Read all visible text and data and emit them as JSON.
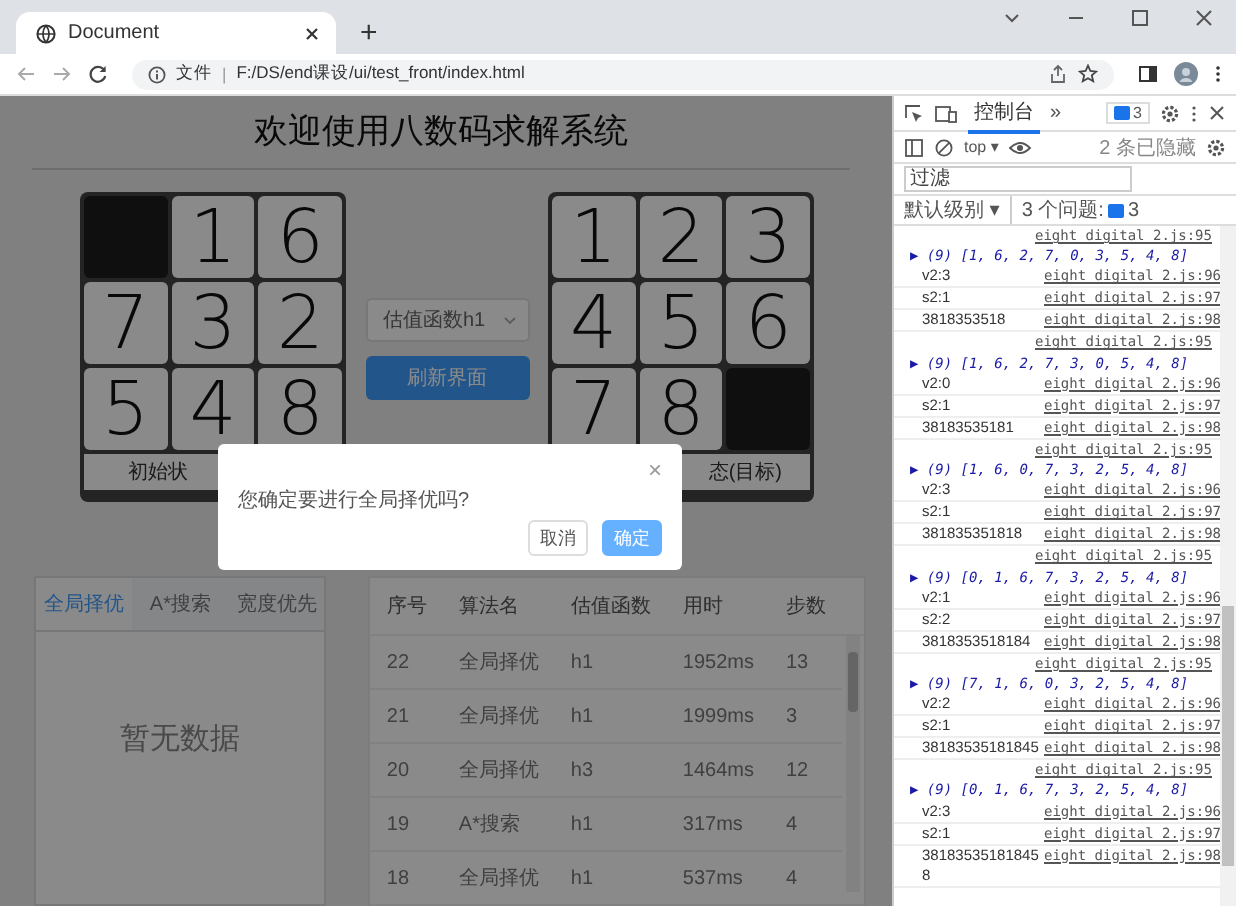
{
  "browser": {
    "tab_title": "Document",
    "new_tab": "+",
    "address_scheme": "文件",
    "address_separator": "|",
    "address": "F:/DS/end课设/ui/test_front/index.html"
  },
  "app": {
    "title": "欢迎使用八数码求解系统",
    "puzzles": [
      {
        "caption": "初始状",
        "tiles": [
          {
            "kind": "blank"
          },
          {
            "kind": "number",
            "label": "1"
          },
          {
            "kind": "number",
            "label": "6"
          },
          {
            "kind": "number",
            "label": "7"
          },
          {
            "kind": "number",
            "label": "3"
          },
          {
            "kind": "number",
            "label": "2"
          },
          {
            "kind": "number",
            "label": "5"
          },
          {
            "kind": "number",
            "label": "4"
          },
          {
            "kind": "number",
            "label": "8"
          }
        ]
      },
      {
        "caption": "态(目标)",
        "tiles": [
          {
            "kind": "number",
            "label": "1"
          },
          {
            "kind": "number",
            "label": "2"
          },
          {
            "kind": "number",
            "label": "3"
          },
          {
            "kind": "number",
            "label": "4"
          },
          {
            "kind": "number",
            "label": "5"
          },
          {
            "kind": "number",
            "label": "6"
          },
          {
            "kind": "number",
            "label": "7"
          },
          {
            "kind": "number",
            "label": "8"
          },
          {
            "kind": "blank"
          }
        ]
      }
    ],
    "select": {
      "value": "估值函数h1"
    },
    "refresh_button": "刷新界面",
    "result_tabs": [
      {
        "label": "全局择优",
        "selected": true
      },
      {
        "label": "A*搜索",
        "selected": false
      },
      {
        "label": "宽度优先",
        "selected": false
      }
    ],
    "empty_text": "暂无数据",
    "table": {
      "columns": [
        "序号",
        "算法名",
        "估值函数",
        "用时",
        "步数"
      ],
      "rows": [
        [
          "22",
          "全局择优",
          "h1",
          "1952ms",
          "13"
        ],
        [
          "21",
          "全局择优",
          "h1",
          "1999ms",
          "3"
        ],
        [
          "20",
          "全局择优",
          "h3",
          "1464ms",
          "12"
        ],
        [
          "19",
          "A*搜索",
          "h1",
          "317ms",
          "4"
        ],
        [
          "18",
          "全局择优",
          "h1",
          "537ms",
          "4"
        ]
      ]
    }
  },
  "dialog": {
    "message": "您确定要进行全局择优吗?",
    "close": "×",
    "buttons": [
      {
        "label": "取消",
        "kind": "plain"
      },
      {
        "label": "确定",
        "kind": "primary"
      }
    ]
  },
  "devtools": {
    "tabs": [
      {
        "label": "控制台",
        "selected": true
      }
    ],
    "more": "»",
    "issues_badge": "3",
    "context": "top ▾",
    "hidden_count": "2 条已隐藏",
    "filter": {
      "placeholder": "过滤"
    },
    "levels": "默认级别 ▾",
    "issues_label": "3 个问题:",
    "issues_count": "3",
    "console": [
      {
        "kind": "source",
        "source": "eight_digital_2.js:95"
      },
      {
        "kind": "array",
        "text": "▶ (9) [1, 6, 2, 7, 0, 3, 5, 4, 8]"
      },
      {
        "kind": "log",
        "text": "v2:3",
        "source": "eight_digital_2.js:96"
      },
      {
        "kind": "log",
        "text": "s2:1",
        "source": "eight_digital_2.js:97"
      },
      {
        "kind": "log",
        "text": "3818353518",
        "source": "eight_digital_2.js:98"
      },
      {
        "kind": "source",
        "source": "eight_digital_2.js:95"
      },
      {
        "kind": "array",
        "text": "▶ (9) [1, 6, 2, 7, 3, 0, 5, 4, 8]"
      },
      {
        "kind": "log",
        "text": "v2:0",
        "source": "eight_digital_2.js:96"
      },
      {
        "kind": "log",
        "text": "s2:1",
        "source": "eight_digital_2.js:97"
      },
      {
        "kind": "log",
        "text": "38183535181",
        "source": "eight_digital_2.js:98"
      },
      {
        "kind": "source",
        "source": "eight_digital_2.js:95"
      },
      {
        "kind": "array",
        "text": "▶ (9) [1, 6, 0, 7, 3, 2, 5, 4, 8]"
      },
      {
        "kind": "log",
        "text": "v2:3",
        "source": "eight_digital_2.js:96"
      },
      {
        "kind": "log",
        "text": "s2:1",
        "source": "eight_digital_2.js:97"
      },
      {
        "kind": "log",
        "text": "381835351818",
        "source": "eight_digital_2.js:98"
      },
      {
        "kind": "source",
        "source": "eight_digital_2.js:95"
      },
      {
        "kind": "array",
        "text": "▶ (9) [0, 1, 6, 7, 3, 2, 5, 4, 8]"
      },
      {
        "kind": "log",
        "text": "v2:1",
        "source": "eight_digital_2.js:96"
      },
      {
        "kind": "log",
        "text": "s2:2",
        "source": "eight_digital_2.js:97"
      },
      {
        "kind": "log",
        "text": "3818353518184",
        "source": "eight_digital_2.js:98"
      },
      {
        "kind": "source",
        "source": "eight_digital_2.js:95"
      },
      {
        "kind": "array",
        "text": "▶ (9) [7, 1, 6, 0, 3, 2, 5, 4, 8]"
      },
      {
        "kind": "log",
        "text": "v2:2",
        "source": "eight_digital_2.js:96"
      },
      {
        "kind": "log",
        "text": "s2:1",
        "source": "eight_digital_2.js:97"
      },
      {
        "kind": "log",
        "text": "38183535181845",
        "source": "eight_digital_2.js:98"
      },
      {
        "kind": "source",
        "source": "eight_digital_2.js:95"
      },
      {
        "kind": "array",
        "text": "▶ (9) [0, 1, 6, 7, 3, 2, 5, 4, 8]"
      },
      {
        "kind": "log",
        "text": "v2:3",
        "source": "eight_digital_2.js:96"
      },
      {
        "kind": "log",
        "text": "s2:1",
        "source": "eight_digital_2.js:97"
      },
      {
        "kind": "log",
        "text": "381835351818458",
        "source": "eight_digital_2.js:98"
      }
    ]
  }
}
